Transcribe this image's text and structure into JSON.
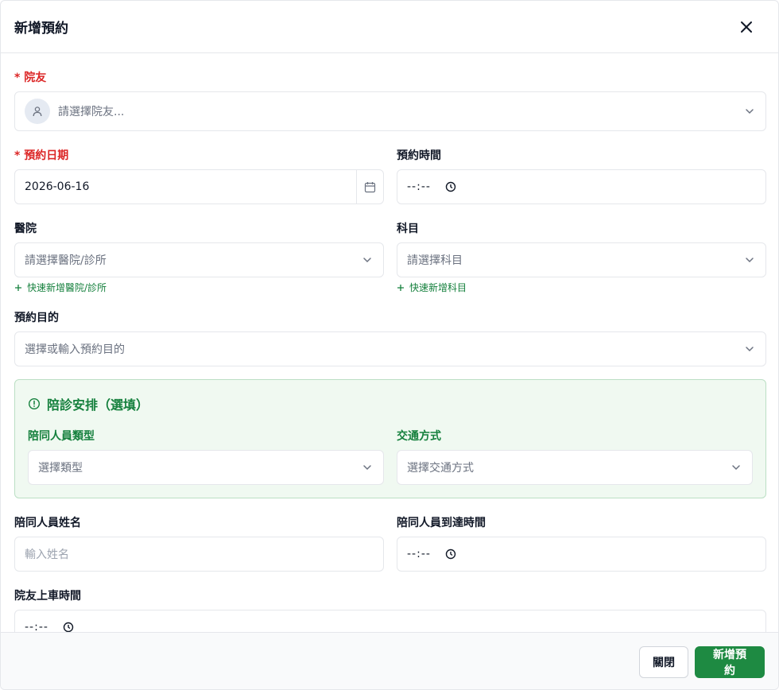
{
  "dialog": {
    "title": "新增預約",
    "close_label": "×"
  },
  "resident": {
    "label": "* 院友",
    "placeholder": "請選擇院友..."
  },
  "date": {
    "label": "* 預約日期",
    "value": "2026-06-16"
  },
  "time": {
    "label": "預約時間",
    "value": "--:--"
  },
  "hospital": {
    "label": "醫院",
    "placeholder": "請選擇醫院/診所",
    "quick_add": "快速新增醫院/診所"
  },
  "department": {
    "label": "科目",
    "placeholder": "請選擇科目",
    "quick_add": "快速新增科目"
  },
  "purpose": {
    "label": "預約目的",
    "placeholder": "選擇或輸入預約目的"
  },
  "escort": {
    "title": "陪診安排（選填）",
    "type_label": "陪同人員類型",
    "type_placeholder": "選擇類型",
    "transport_label": "交通方式",
    "transport_placeholder": "選擇交通方式"
  },
  "escort_name": {
    "label": "陪同人員姓名",
    "placeholder": "輸入姓名"
  },
  "escort_arrival": {
    "label": "陪同人員到達時間",
    "value": "--:--"
  },
  "boarding": {
    "label": "院友上車時間",
    "value": "--:--"
  },
  "footer": {
    "close_label": "關閉",
    "submit_label": "新增預約"
  },
  "colors": {
    "required": "#dc2626",
    "accent_green": "#15803d",
    "primary_button": "#1e8a42"
  }
}
